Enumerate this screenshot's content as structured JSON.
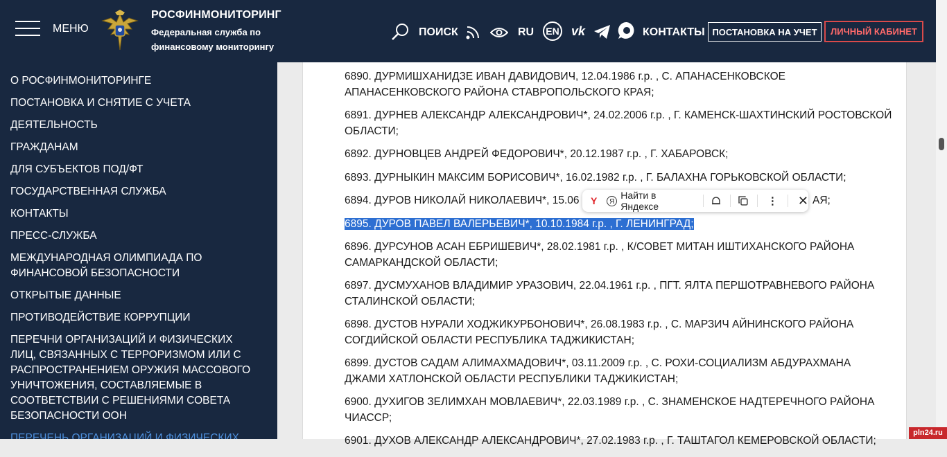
{
  "header": {
    "menu_label": "МЕНЮ",
    "brand_title": "РОСФИНМОНИТОРИНГ",
    "brand_sub_line1": "Федеральная служба по",
    "brand_sub_line2": "финансовому мониторингу",
    "search_label": "ПОИСК",
    "lang_ru": "RU",
    "lang_en": "EN",
    "contacts_label": "КОНТАКТЫ",
    "register_button": "ПОСТАНОВКА НА УЧЕТ",
    "cabinet_button": "ЛИЧНЫЙ КАБИНЕТ",
    "cabinet_color": "#ff6a6a"
  },
  "sidebar": {
    "items": [
      "О РОСФИНМОНИТОРИНГЕ",
      "ПОСТАНОВКА И СНЯТИЕ С УЧЕТА",
      "ДЕЯТЕЛЬНОСТЬ",
      "ГРАЖДАНАМ",
      "ДЛЯ СУБЪЕКТОВ ПОД/ФТ",
      "ГОСУДАРСТВЕННАЯ СЛУЖБА",
      "КОНТАКТЫ",
      "ПРЕСС-СЛУЖБА",
      "МЕЖДУНАРОДНАЯ ОЛИМПИАДА ПО ФИНАНСОВОЙ БЕЗОПАСНОСТИ",
      "ОТКРЫТЫЕ ДАННЫЕ",
      "ПРОТИВОДЕЙСТВИЕ КОРРУПЦИИ",
      "ПЕРЕЧНИ ОРГАНИЗАЦИЙ И ФИЗИЧЕСКИХ ЛИЦ, СВЯЗАННЫХ С ТЕРРОРИЗМОМ ИЛИ С РАСПРОСТРАНЕНИЕМ ОРУЖИЯ МАССОВОГО УНИЧТОЖЕНИЯ, СОСТАВЛЯЕМЫЕ В СООТВЕТСТВИИ С РЕШЕНИЯМИ СОВЕТА БЕЗОПАСНОСТИ ООН",
      "ПЕРЕЧЕНЬ ОРГАНИЗАЦИЙ И ФИЗИЧЕСКИХ"
    ],
    "active_index": 12,
    "active_color": "#4d8fdc"
  },
  "entries": [
    "6890. ДУРМИШХАНИДЗЕ ИВАН ДАВИДОВИЧ, 12.04.1986 г.р. , С. АПАНАСЕНКОВСКОЕ АПАНАСЕНКОВСКОГО РАЙОНА СТАВРОПОЛЬСКОГО КРАЯ;",
    "6891. ДУРНЕВ АЛЕКСАНДР АЛЕКСАНДРОВИЧ*, 24.02.2006 г.р. , Г. КАМЕНСК-ШАХТИНСКИЙ РОСТОВСКОЙ ОБЛАСТИ;",
    "6892. ДУРНОВЦЕВ АНДРЕЙ ФЕДОРОВИЧ*, 20.12.1987 г.р. , Г. ХАБАРОВСК;",
    "6893. ДУРНЫКИН МАКСИМ БОРИСОВИЧ*, 16.02.1982 г.р. , Г. БАЛАХНА ГОРЬКОВСКОЙ ОБЛАСТИ;",
    "6894. ДУРОВ НИКОЛАЙ НИКОЛАЕВИЧ*, 15.06",
    "6895. ДУРОВ ПАВЕЛ ВАЛЕРЬЕВИЧ*, 10.10.1984 г.р. , Г. ЛЕНИНГРАД;",
    "6896. ДУРСУНОВ АСАН ЕБРИШЕВИЧ*, 28.02.1981 г.р. , К/СОВЕТ МИТАН ИШТИХАНСКОГО РАЙОНА САМАРКАНДСКОЙ ОБЛАСТИ;",
    "6897. ДУСМУХАНОВ ВЛАДИМИР УРАЗОВИЧ, 22.04.1961 г.р. , ПГТ. ЯЛТА ПЕРШОТРАВНЕВОГО РАЙОНА СТАЛИНСКОЙ ОБЛАСТИ;",
    "6898. ДУСТОВ НУРАЛИ ХОДЖИКУРБОНОВИЧ*, 26.08.1983 г.р. , С. МАРЗИЧ АЙНИНСКОГО РАЙОНА СОГДИЙСКОЙ ОБЛАСТИ РЕСПУБЛИКА ТАДЖИКИСТАН;",
    "6899. ДУСТОВ САДАМ АЛИМАХМАДОВИЧ*, 03.11.2009 г.р. , С. РОХИ-СОЦИАЛИЗМ АБДУРАХМАНА ДЖАМИ ХАТЛОНСКОЙ ОБЛАСТИ РЕСПУБЛИКИ ТАДЖИКИСТАН;",
    "6900. ДУХИГОВ ЗЕЛИМХАН МОВЛАЕВИЧ*, 22.03.1989 г.р. , С. ЗНАМЕНСКОЕ НАДТЕРЕЧНОГО РАЙОНА ЧИАССР;",
    "6901. ДУХОВ АЛЕКСАНДР АЛЕКСАНДРОВИЧ*, 27.02.1983 г.р. , Г. ТАШТАГОЛ КЕМЕРОВСКОЙ ОБЛАСТИ;"
  ],
  "entry_6894_tail": "АЯ;",
  "highlighted_index": 5,
  "highlight_color": "#2d6fd2",
  "popup": {
    "yandex_label": "Найти в Яндексе",
    "yandex_logo_letter": "Y"
  },
  "watermark": "pln24.ru",
  "icons": [
    "hamburger-icon",
    "emblem-icon",
    "search-icon",
    "audio-icon",
    "eye-icon",
    "vk-icon",
    "telegram-icon",
    "chat-icon",
    "yandex-icon",
    "bell-icon",
    "copy-icon",
    "more-icon",
    "close-icon"
  ]
}
